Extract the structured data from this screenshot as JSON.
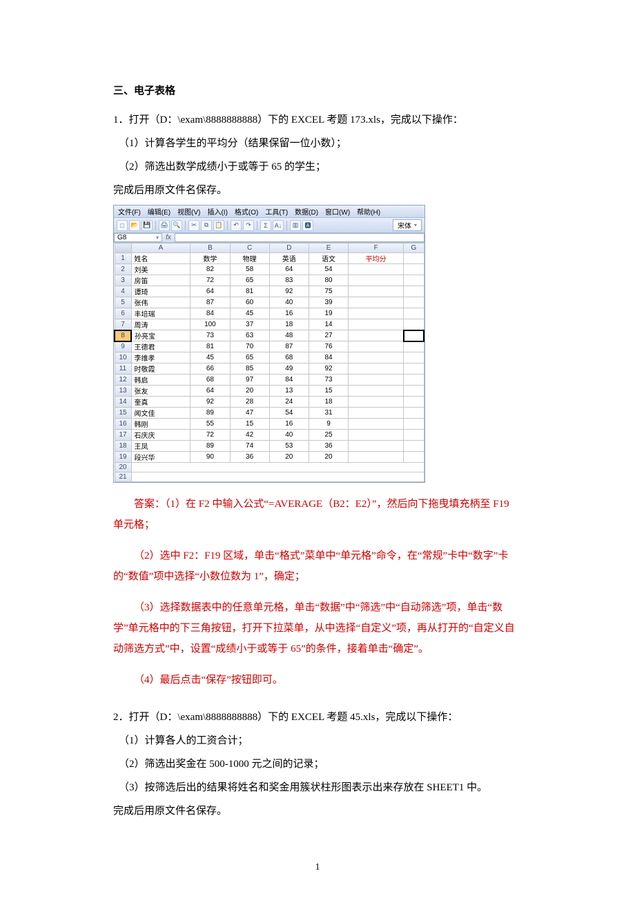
{
  "doc": {
    "section_title": "三、电子表格",
    "q1": {
      "stem": "1．打开（D：\\exam\\8888888888）下的 EXCEL 考题 173.xls，完成以下操作：",
      "item1": "（1）计算各学生的平均分（结果保留一位小数）；",
      "item2": "（2）筛选出数学成绩小于或等于 65 的学生；",
      "save": "完成后用原文件名保存。"
    },
    "excel": {
      "menus": [
        "文件(F)",
        "编辑(E)",
        "视图(V)",
        "插入(I)",
        "格式(O)",
        "工具(T)",
        "数据(D)",
        "窗口(W)",
        "帮助(H)"
      ],
      "font_name": "宋体",
      "active_cell": "G8",
      "cols": [
        "A",
        "B",
        "C",
        "D",
        "E",
        "F",
        "G"
      ],
      "header_labels": [
        "姓名",
        "数学",
        "物理",
        "英语",
        "语文",
        "平均分"
      ],
      "rows": [
        {
          "n": "刘美",
          "v": [
            82,
            58,
            64,
            54
          ]
        },
        {
          "n": "房笛",
          "v": [
            72,
            65,
            83,
            80
          ]
        },
        {
          "n": "谭琦",
          "v": [
            64,
            81,
            92,
            75
          ]
        },
        {
          "n": "张伟",
          "v": [
            87,
            60,
            40,
            39
          ]
        },
        {
          "n": "丰培瑞",
          "v": [
            84,
            45,
            16,
            19
          ]
        },
        {
          "n": "周涛",
          "v": [
            100,
            37,
            18,
            14
          ]
        },
        {
          "n": "孙亮宝",
          "v": [
            73,
            63,
            48,
            27
          ]
        },
        {
          "n": "王德君",
          "v": [
            81,
            70,
            87,
            76
          ]
        },
        {
          "n": "李维孝",
          "v": [
            45,
            65,
            68,
            84
          ]
        },
        {
          "n": "时敬霞",
          "v": [
            66,
            85,
            49,
            92
          ]
        },
        {
          "n": "韩启",
          "v": [
            68,
            97,
            84,
            73
          ]
        },
        {
          "n": "张友",
          "v": [
            64,
            20,
            13,
            15
          ]
        },
        {
          "n": "奎真",
          "v": [
            92,
            28,
            24,
            18
          ]
        },
        {
          "n": "闻文佳",
          "v": [
            89,
            47,
            54,
            31
          ]
        },
        {
          "n": "韩刚",
          "v": [
            55,
            15,
            16,
            9
          ]
        },
        {
          "n": "石庆庆",
          "v": [
            72,
            42,
            40,
            25
          ]
        },
        {
          "n": "王凤",
          "v": [
            89,
            74,
            53,
            36
          ]
        },
        {
          "n": "段兴华",
          "v": [
            90,
            36,
            20,
            20
          ]
        }
      ]
    },
    "ans": {
      "line1_prefix": "答案：",
      "line1": "（1）在 F2 中输入公式“=AVERAGE（B2：E2）”，然后向下拖曳填充柄至 F19 单元格；",
      "line2a": "（2）选中 F2：F19 区域，单击“格式”菜单中“单元格”命令，在“常规”卡中“数字”卡的“数值”项中选择“小数位数为 1”，确定；",
      "line3a": "（3）选择数据表中的任意单元格，单击“数据”中“筛选”中“自动筛选”项，单击“数学”单元格中的下三角按钮，打开下拉菜单，从中选择“自定义”项，再从打开的“自定义自动筛选方式”中，设置“成绩小于或等于 65”的条件，接着单击“确定”。",
      "line4": "（4）最后点击“保存”按钮即可。"
    },
    "q2": {
      "stem": "2．打开（D：\\exam\\8888888888）下的 EXCEL 考题 45.xls，完成以下操作：",
      "item1": "（1）计算各人的工资合计；",
      "item2": "（2）筛选出奖金在 500-1000 元之间的记录；",
      "item3": "（3）按筛选后出的结果将姓名和奖金用簇状柱形图表示出来存放在 SHEET1 中。",
      "save": "完成后用原文件名保存。"
    },
    "page_number": "1"
  }
}
